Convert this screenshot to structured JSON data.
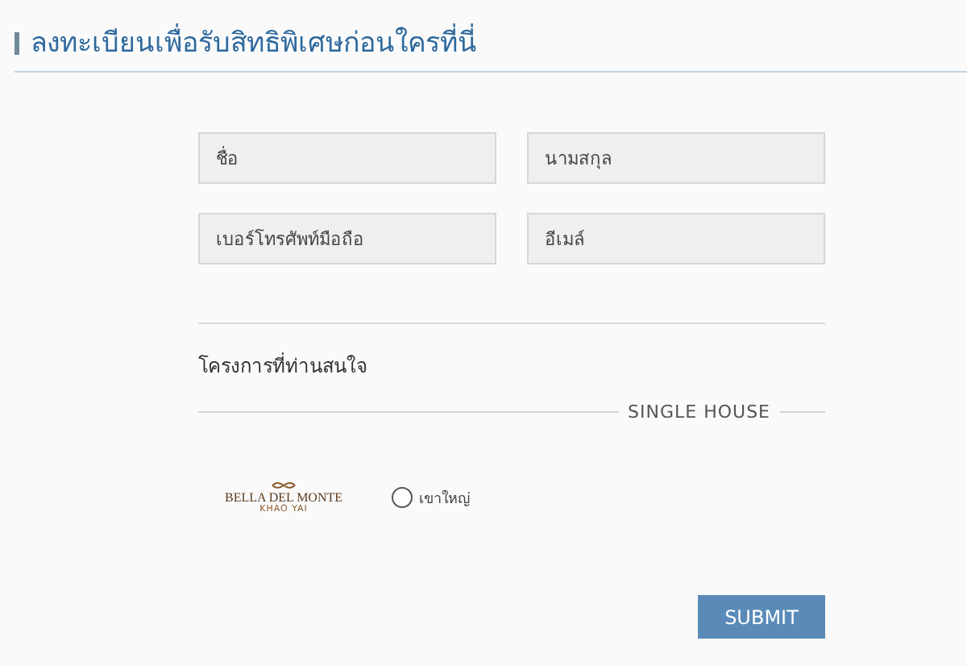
{
  "title": "ลงทะเบียนเพื่อรับสิทธิพิเศษก่อนใครที่นี่",
  "fields": [
    {
      "placeholder": "ชื่อ"
    },
    {
      "placeholder": "นามสกุล"
    },
    {
      "placeholder": "เบอร์โทรศัพท์มือถือ"
    },
    {
      "placeholder": "อีเมล์"
    }
  ],
  "interest_label": "โครงการที่ท่านสนใจ",
  "category": "SINGLE HOUSE",
  "projects": [
    {
      "logo_name": "BELLA DEL MONTE",
      "logo_sub": "KHAO YAI",
      "label": "เขาใหญ่",
      "selected": false
    }
  ],
  "submit": "SUBMIT"
}
